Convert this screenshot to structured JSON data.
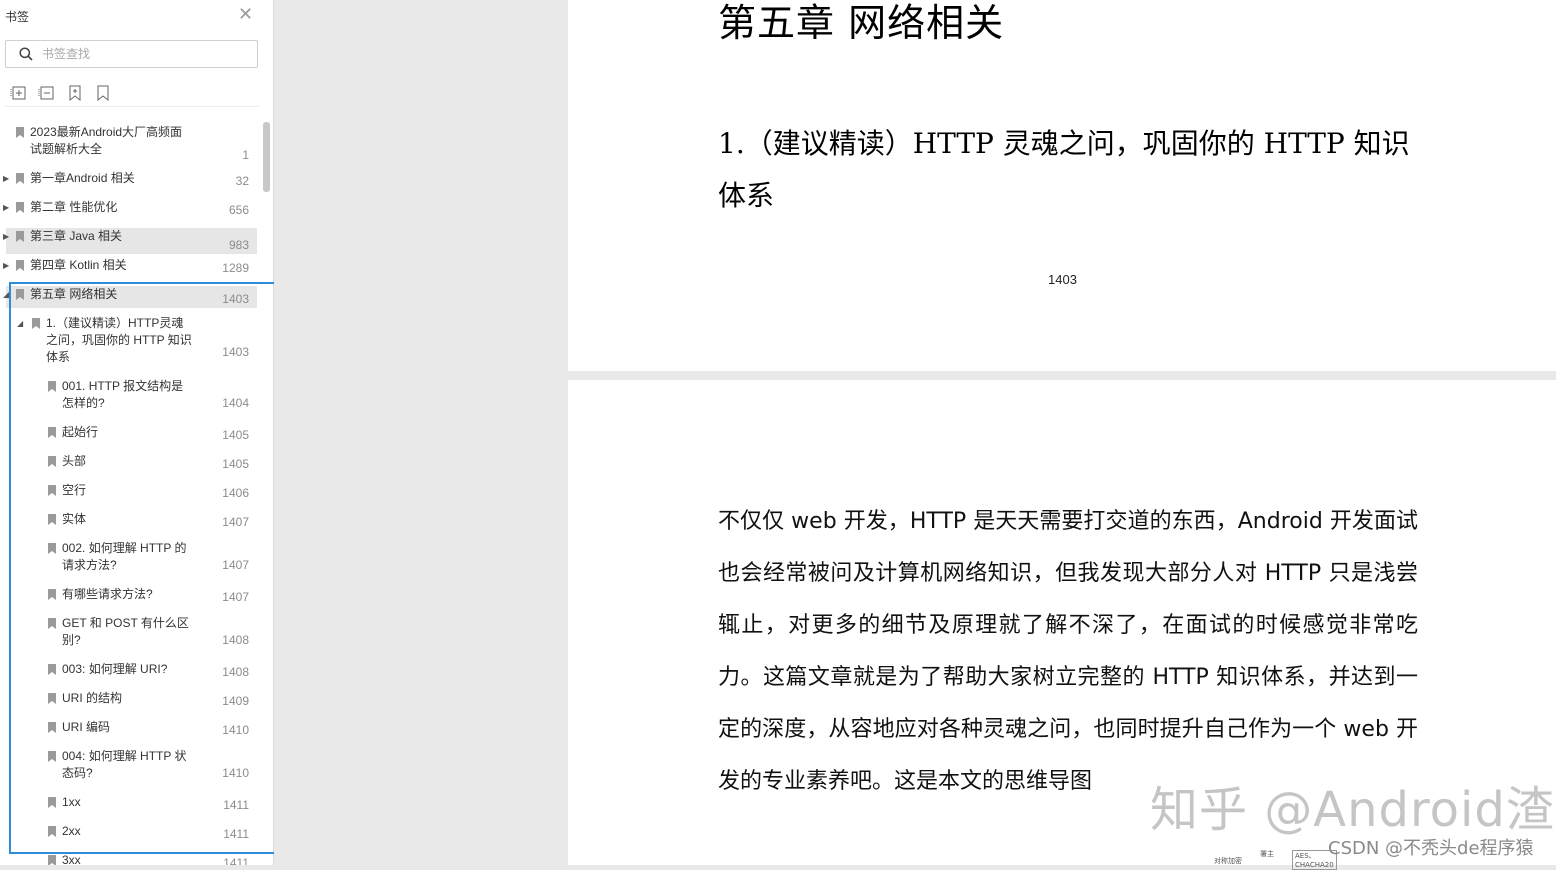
{
  "sidebar": {
    "title": "书签",
    "close_icon": "close-icon",
    "search": {
      "placeholder": "书签查找",
      "value": ""
    },
    "toolbar": [
      "expand-all-icon",
      "collapse-all-icon",
      "add-bookmark-icon",
      "bookmark-icon"
    ],
    "items": [
      {
        "label_lines": [
          "2023最新Android大厂高频面",
          "试题解析大全"
        ],
        "page": "1",
        "level": 0,
        "expander": "",
        "selected": false
      },
      {
        "label_lines": [
          "第一章Android 相关"
        ],
        "page": "32",
        "level": 0,
        "expander": "collapsed",
        "selected": false
      },
      {
        "label_lines": [
          "第二章 性能优化"
        ],
        "page": "656",
        "level": 0,
        "expander": "collapsed",
        "selected": false
      },
      {
        "label_lines": [
          "第三章 Java 相关"
        ],
        "page": "983",
        "level": 0,
        "expander": "collapsed",
        "selected": true
      },
      {
        "label_lines": [
          "第四章 Kotlin 相关"
        ],
        "page": "1289",
        "level": 0,
        "expander": "collapsed",
        "selected": false
      },
      {
        "label_lines": [
          "第五章 网络相关"
        ],
        "page": "1403",
        "level": 0,
        "expander": "expanded",
        "selected": true
      },
      {
        "label_lines": [
          "1.（建议精读）HTTP灵魂",
          "之问，巩固你的 HTTP 知识",
          "体系"
        ],
        "page": "1403",
        "level": 1,
        "expander": "expanded",
        "selected": false
      },
      {
        "label_lines": [
          "001. HTTP 报文结构是",
          "怎样的?"
        ],
        "page": "1404",
        "level": 2,
        "expander": "",
        "selected": false
      },
      {
        "label_lines": [
          "起始行"
        ],
        "page": "1405",
        "level": 2,
        "expander": "",
        "selected": false
      },
      {
        "label_lines": [
          "头部"
        ],
        "page": "1405",
        "level": 2,
        "expander": "",
        "selected": false
      },
      {
        "label_lines": [
          "空行"
        ],
        "page": "1406",
        "level": 2,
        "expander": "",
        "selected": false
      },
      {
        "label_lines": [
          "实体"
        ],
        "page": "1407",
        "level": 2,
        "expander": "",
        "selected": false
      },
      {
        "label_lines": [
          "002. 如何理解 HTTP 的",
          "请求方法?"
        ],
        "page": "1407",
        "level": 2,
        "expander": "",
        "selected": false
      },
      {
        "label_lines": [
          "有哪些请求方法?"
        ],
        "page": "1407",
        "level": 2,
        "expander": "",
        "selected": false
      },
      {
        "label_lines": [
          "GET 和 POST 有什么区",
          "别?"
        ],
        "page": "1408",
        "level": 2,
        "expander": "",
        "selected": false
      },
      {
        "label_lines": [
          "003: 如何理解 URI?"
        ],
        "page": "1408",
        "level": 2,
        "expander": "",
        "selected": false
      },
      {
        "label_lines": [
          "URI 的结构"
        ],
        "page": "1409",
        "level": 2,
        "expander": "",
        "selected": false
      },
      {
        "label_lines": [
          "URI 编码"
        ],
        "page": "1410",
        "level": 2,
        "expander": "",
        "selected": false
      },
      {
        "label_lines": [
          "004: 如何理解 HTTP 状",
          "态码?"
        ],
        "page": "1410",
        "level": 2,
        "expander": "",
        "selected": false
      },
      {
        "label_lines": [
          "1xx"
        ],
        "page": "1411",
        "level": 2,
        "expander": "",
        "selected": false
      },
      {
        "label_lines": [
          "2xx"
        ],
        "page": "1411",
        "level": 2,
        "expander": "",
        "selected": false
      },
      {
        "label_lines": [
          "3xx"
        ],
        "page": "1411",
        "level": 2,
        "expander": "",
        "selected": false
      }
    ]
  },
  "document": {
    "page1": {
      "chapter_title": "第五章  网络相关",
      "section_title": "1.（建议精读）HTTP 灵魂之问，巩固你的 HTTP 知识体系",
      "page_number": "1403"
    },
    "page2": {
      "paragraph": "不仅仅 web 开发，HTTP 是天天需要打交道的东西，Android 开发面试也会经常被问及计算机网络知识，但我发现大部分人对 HTTP 只是浅尝辄止，对更多的细节及原理就了解不深了，在面试的时候感觉非常吃力。这篇文章就是为了帮助大家树立完整的 HTTP 知识体系，并达到一定的深度，从容地应对各种灵魂之问，也同时提升自己作为一个 web 开发的专业素养吧。这是本文的思维导图",
      "diagram_fragments": [
        "对称加密",
        "署主",
        "AES、CHACHA20"
      ]
    }
  },
  "overlays": {
    "watermark": "知乎 @Android渣",
    "csdn": "CSDN @不秃头de程序猿"
  },
  "colors": {
    "highlight_border": "#2a8fd6",
    "selected_row": "#e6e6e6",
    "page_number": "#8c8c8c"
  }
}
